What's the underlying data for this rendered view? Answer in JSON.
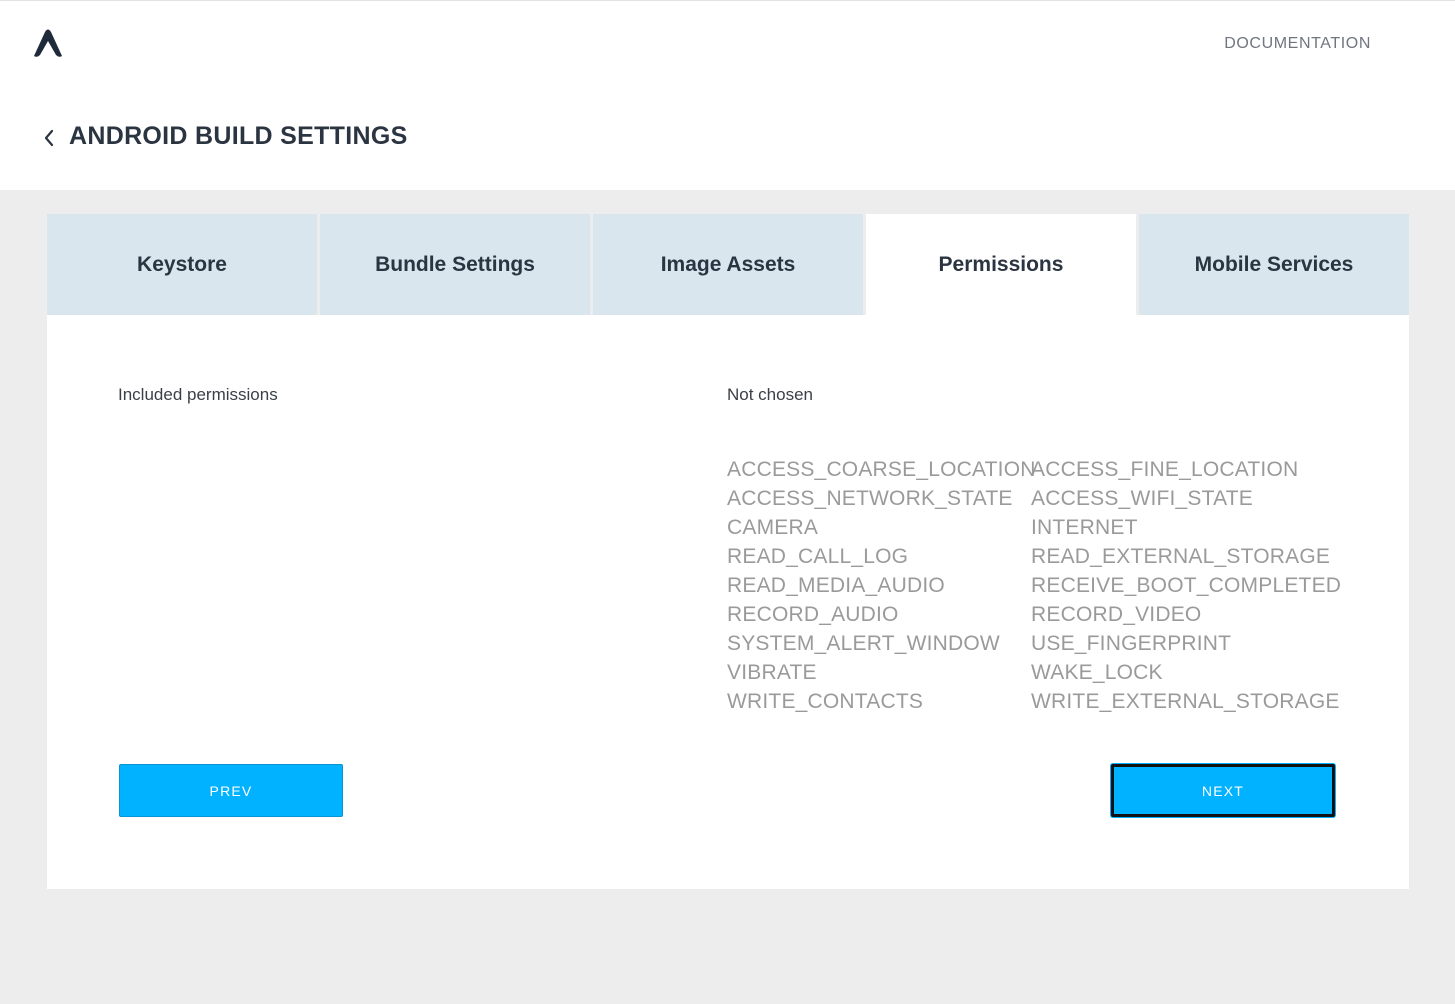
{
  "header": {
    "logo_icon": "app-logo-icon",
    "documentation_label": "DOCUMENTATION",
    "back_icon": "chevron-left-icon",
    "page_title": "ANDROID BUILD SETTINGS"
  },
  "tabs": [
    {
      "label": "Keystore",
      "active": false
    },
    {
      "label": "Bundle Settings",
      "active": false
    },
    {
      "label": "Image Assets",
      "active": false
    },
    {
      "label": "Permissions",
      "active": true
    },
    {
      "label": "Mobile Services",
      "active": false
    }
  ],
  "permissions": {
    "included_label": "Included permissions",
    "not_chosen_label": "Not chosen",
    "not_chosen": [
      "ACCESS_COARSE_LOCATION",
      "ACCESS_FINE_LOCATION",
      "ACCESS_NETWORK_STATE",
      "ACCESS_WIFI_STATE",
      "CAMERA",
      "INTERNET",
      "READ_CALL_LOG",
      "READ_EXTERNAL_STORAGE",
      "READ_MEDIA_AUDIO",
      "RECEIVE_BOOT_COMPLETED",
      "RECORD_AUDIO",
      "RECORD_VIDEO",
      "SYSTEM_ALERT_WINDOW",
      "USE_FINGERPRINT",
      "VIBRATE",
      "WAKE_LOCK",
      "WRITE_CONTACTS",
      "WRITE_EXTERNAL_STORAGE"
    ]
  },
  "buttons": {
    "prev_label": "PREV",
    "next_label": "NEXT"
  },
  "colors": {
    "accent": "#00b2ff",
    "tab_inactive": "#d9e6ee",
    "page_background": "#ededed"
  }
}
